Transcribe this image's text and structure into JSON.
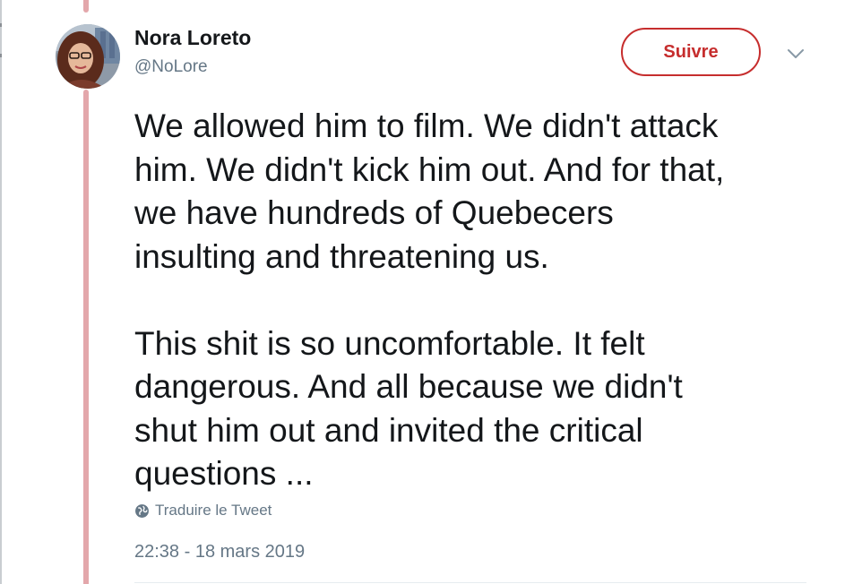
{
  "tweet": {
    "author_name": "Nora Loreto",
    "author_handle": "@NoLore",
    "follow_label": "Suivre",
    "paragraphs": [
      "We allowed him to film. We didn't attack\nhim. We didn't kick him out. And for that,\nwe have hundreds of Quebecers\ninsulting and threatening us.",
      "This shit is so uncomfortable. It felt\ndangerous. And all because we didn't\nshut him out and invited the critical\nquestions ..."
    ],
    "translate_label": "Traduire le Tweet",
    "timestamp": "22:38 - 18 mars 2019"
  },
  "icons": {
    "more": "chevron-down-icon",
    "translate": "globe-icon"
  },
  "colors": {
    "follow_accent": "#c62d2d",
    "thread_line": "#e3a7ab",
    "muted_text": "#657786",
    "body_text": "#14171a"
  }
}
